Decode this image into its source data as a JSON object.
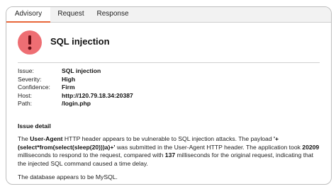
{
  "tabs": [
    {
      "label": "Advisory",
      "active": true
    },
    {
      "label": "Request",
      "active": false
    },
    {
      "label": "Response",
      "active": false
    }
  ],
  "issue_title": "SQL injection",
  "icon": "alert-circle-icon",
  "colors": {
    "accent": "#e8663a",
    "alert": "#ee6e73"
  },
  "info": [
    {
      "label": "Issue:",
      "value": "SQL injection"
    },
    {
      "label": "Severity:",
      "value": "High"
    },
    {
      "label": "Confidence:",
      "value": "Firm"
    },
    {
      "label": "Host:",
      "value": "http://120.79.18.34:20387"
    },
    {
      "label": "Path:",
      "value": "/login.php"
    }
  ],
  "detail": {
    "heading": "Issue detail",
    "p1": {
      "t1": "The ",
      "header_name": "User-Agent",
      "t2": " HTTP header appears to be vulnerable to SQL injection attacks. The payload ",
      "payload": "'+(select*from(select(sleep(20)))a)+'",
      "t3": " was submitted in the User-Agent HTTP header. The application took ",
      "ms_payload": "20209",
      "t4": " milliseconds to respond to the request, compared with ",
      "ms_original": "137",
      "t5": " milliseconds for the original request, indicating that the injected SQL command caused a time delay."
    },
    "p2": "The database appears to be MySQL."
  }
}
